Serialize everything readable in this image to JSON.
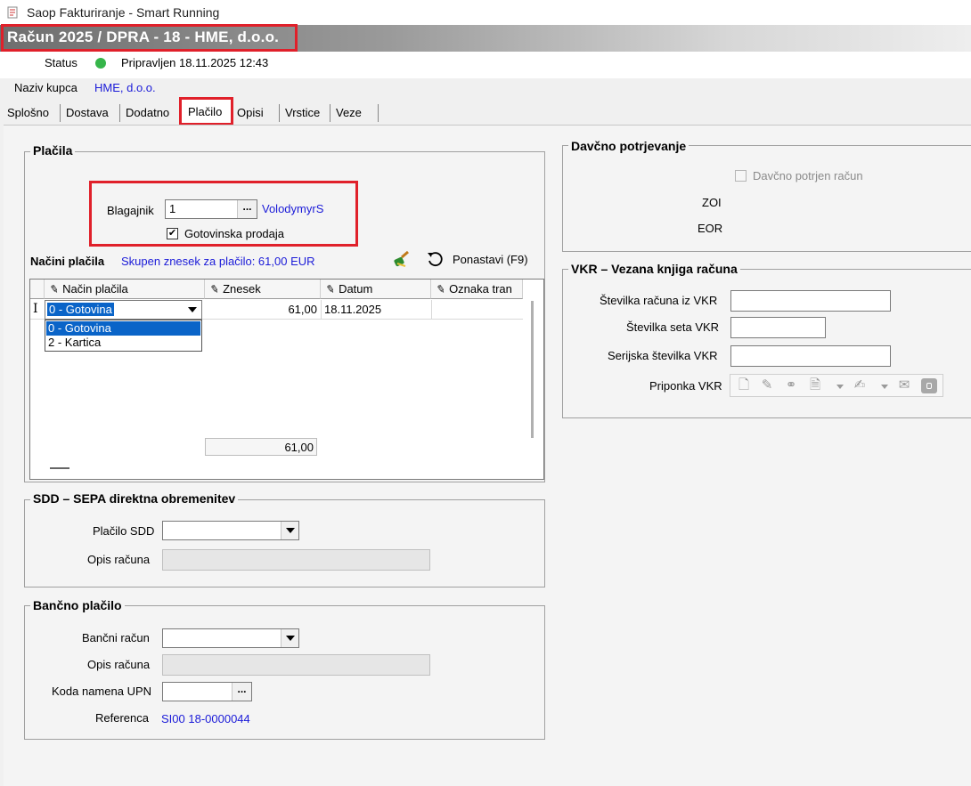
{
  "window": {
    "title": "Saop Fakturiranje - Smart Running"
  },
  "document": {
    "title": "Račun  2025 / DPRA - 18 - HME, d.o.o."
  },
  "status": {
    "label": "Status",
    "value": "Pripravljen 18.11.2025 12:43",
    "dot_color": "#36b54a"
  },
  "customer": {
    "label": "Naziv kupca",
    "value": "HME, d.o.o."
  },
  "tabs": [
    {
      "label": "Splošno"
    },
    {
      "label": "Dostava"
    },
    {
      "label": "Dodatno"
    },
    {
      "label": "Plačilo"
    },
    {
      "label": "Opisi"
    },
    {
      "label": "Vrstice"
    },
    {
      "label": "Veze"
    }
  ],
  "placila": {
    "title": "Plačila",
    "blagajnik_label": "Blagajnik",
    "blagajnik_value": "1",
    "blagajnik_button": "...",
    "blagajnik_name": "VolodymyrS",
    "gotovinska_label": "Gotovinska prodaja",
    "gotovinska_checked": true,
    "nacini_label": "Načini plačila",
    "skupen_text": "Skupen znesek za plačilo: 61,00 EUR",
    "ponastavi_label": "Ponastavi (F9)",
    "grid": {
      "columns": [
        "Način plačila",
        "Znesek",
        "Datum",
        "Oznaka tran"
      ],
      "row": {
        "nacin": "0 - Gotovina",
        "znesek": "61,00",
        "datum": "18.11.2025"
      },
      "dropdown_options": [
        "0 - Gotovina",
        "2 - Kartica"
      ],
      "total": "61,00"
    }
  },
  "sdd": {
    "title": "SDD – SEPA direktna obremenitev",
    "placilo_label": "Plačilo SDD",
    "placilo_value": "",
    "opis_label": "Opis računa",
    "opis_value": ""
  },
  "bancno": {
    "title": "Bančno plačilo",
    "racun_label": "Bančni račun",
    "racun_value": "",
    "opis_label": "Opis računa",
    "opis_value": "",
    "koda_label": "Koda namena UPN",
    "koda_value": "",
    "koda_button": "...",
    "referenca_label": "Referenca",
    "referenca_value": "SI00 18-0000044"
  },
  "davcno": {
    "title": "Davčno potrjevanje",
    "potrjen_label": "Davčno potrjen račun",
    "potrjen_checked": false,
    "zoi_label": "ZOI",
    "eor_label": "EOR"
  },
  "vkr": {
    "title": "VKR – Vezana knjiga računa",
    "stevilka_label": "Številka računa iz VKR",
    "seta_label": "Številka seta VKR",
    "serijska_label": "Serijska številka VKR",
    "priponka_label": "Priponka VKR",
    "stevilka_value": "",
    "seta_value": "",
    "serijska_value": "",
    "toolbar_icons": [
      "new-document-icon",
      "edit-document-icon",
      "link-icon",
      "add-attachment-icon",
      "chevron-down-icon",
      "sign-document-icon",
      "chevron-down-icon",
      "certificate-icon",
      "lock-icon"
    ]
  }
}
